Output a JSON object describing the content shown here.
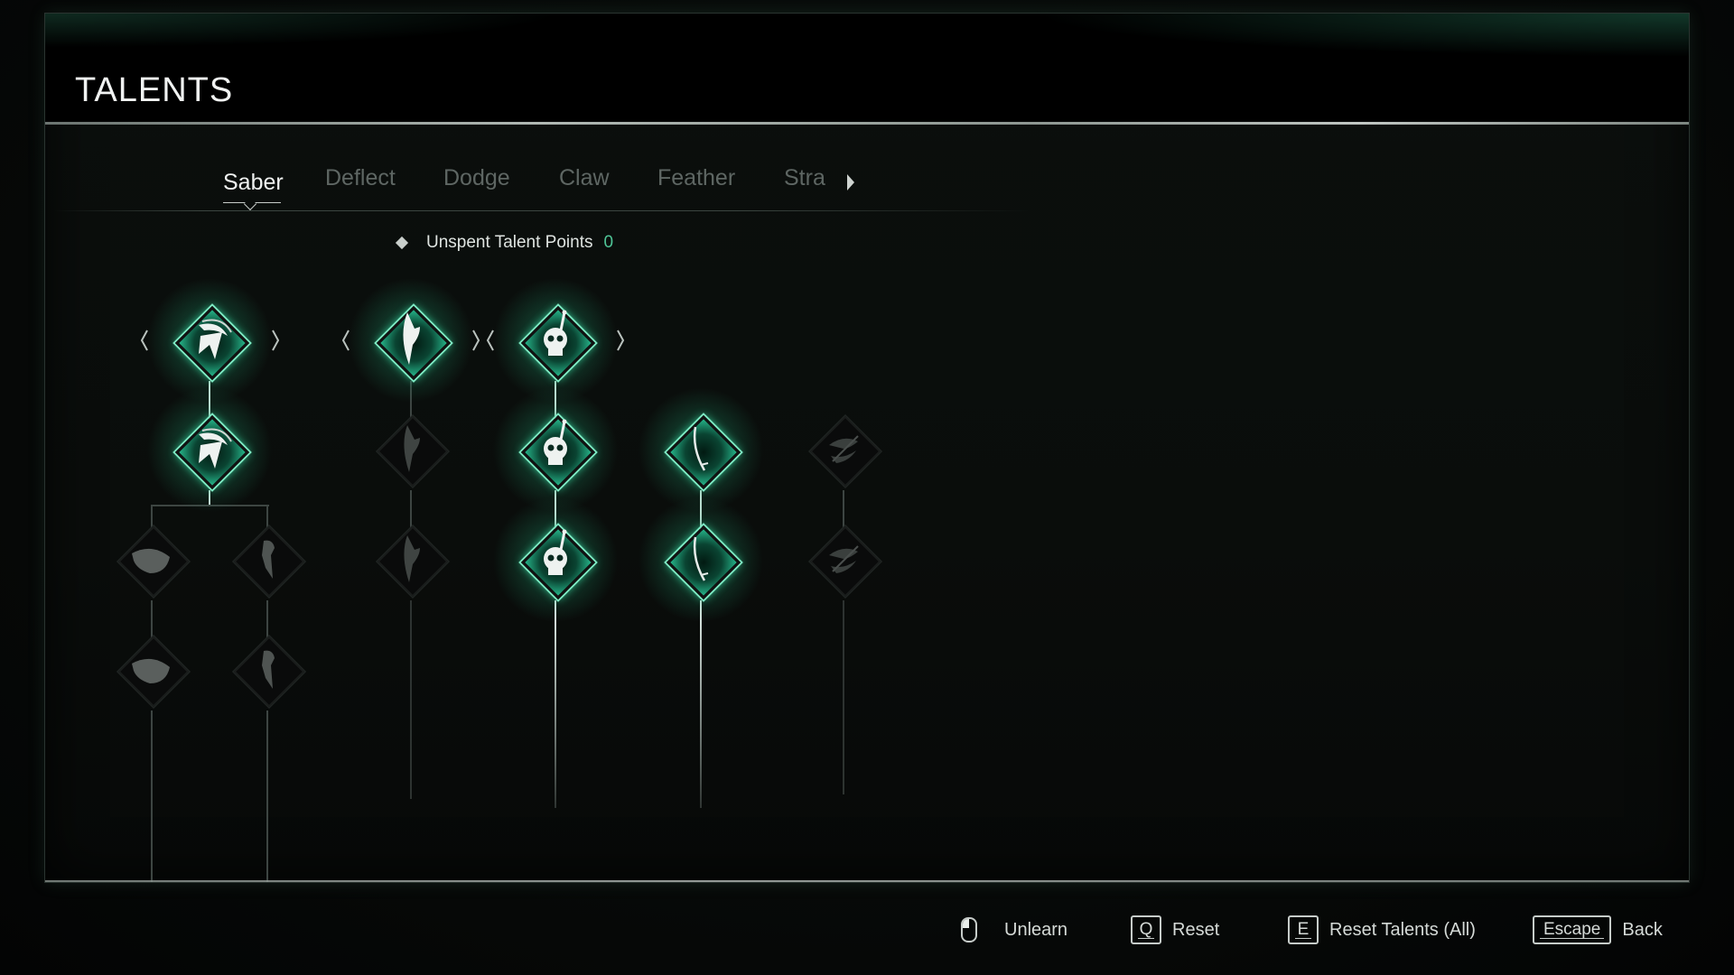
{
  "header": {
    "title": "TALENTS"
  },
  "tabs": [
    {
      "label": "Saber",
      "active": true
    },
    {
      "label": "Deflect",
      "active": false
    },
    {
      "label": "Dodge",
      "active": false
    },
    {
      "label": "Claw",
      "active": false
    },
    {
      "label": "Feather",
      "active": false
    },
    {
      "label": "Stra",
      "active": false
    }
  ],
  "points": {
    "label": "Unspent Talent Points",
    "value": "0"
  },
  "colors": {
    "accent": "#4fc597",
    "glow": "#38d8a0",
    "locked": "#3d4542"
  },
  "talent_tree": {
    "columns": [
      {
        "id": "reaper-slash",
        "icon": "reaper-slash-icon",
        "nodes": [
          {
            "row": 1,
            "state": "learned",
            "has_selector": true
          },
          {
            "row": 2,
            "state": "learned"
          }
        ],
        "branches": [
          {
            "icon": "cloak-spin-icon",
            "nodes": [
              {
                "row": 3,
                "state": "locked"
              },
              {
                "row": 4,
                "state": "locked"
              }
            ]
          },
          {
            "icon": "rising-figure-icon",
            "nodes": [
              {
                "row": 3,
                "state": "locked"
              },
              {
                "row": 4,
                "state": "locked"
              }
            ]
          }
        ]
      },
      {
        "id": "blade-wing",
        "icon": "blade-wing-icon",
        "nodes": [
          {
            "row": 1,
            "state": "learned",
            "has_selector": true
          },
          {
            "row": 2,
            "state": "locked"
          },
          {
            "row": 3,
            "state": "locked"
          }
        ]
      },
      {
        "id": "skull-dagger",
        "icon": "skull-dagger-icon",
        "nodes": [
          {
            "row": 1,
            "state": "learned",
            "has_selector": true
          },
          {
            "row": 2,
            "state": "learned"
          },
          {
            "row": 3,
            "state": "learned"
          }
        ]
      },
      {
        "id": "saber",
        "icon": "saber-icon",
        "nodes": [
          {
            "row": 2,
            "state": "learned"
          },
          {
            "row": 3,
            "state": "learned"
          }
        ]
      },
      {
        "id": "swirl-blade",
        "icon": "swirl-blade-icon",
        "nodes": [
          {
            "row": 2,
            "state": "locked"
          },
          {
            "row": 3,
            "state": "locked"
          }
        ]
      }
    ]
  },
  "footer": {
    "unlearn": {
      "icon": "mouse-left-click-icon",
      "label": "Unlearn"
    },
    "reset": {
      "key": "Q",
      "label": "Reset"
    },
    "reset_all": {
      "key": "E",
      "label": "Reset Talents (All)"
    },
    "back": {
      "key": "Escape",
      "label": "Back"
    }
  }
}
